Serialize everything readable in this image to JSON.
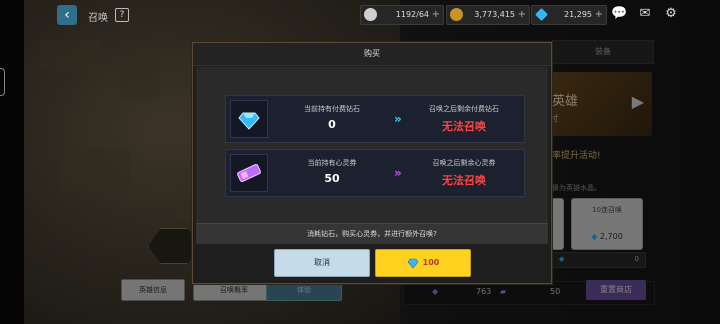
{
  "header": {
    "title": "召唤",
    "help": "?",
    "resources": [
      {
        "name": "stamina",
        "value": "1192/64",
        "color": "#cfcfcf"
      },
      {
        "name": "gold",
        "value": "3,773,415",
        "color": "#c9932a"
      },
      {
        "name": "gems",
        "value": "21,295",
        "color": "#2fb7ff"
      }
    ]
  },
  "right_panel": {
    "tab": "装备",
    "banner_title": "英雄",
    "banner_sub": "付",
    "event_text": "率提升活动!",
    "note": "换为英雄水晶。",
    "card_left_price": "0",
    "card_right_label": "10连召唤",
    "card_right_price": "2,700",
    "strip_value": "0",
    "bottom_count_a": "763",
    "bottom_count_b": "50",
    "shop_button": "重置商店"
  },
  "bottom_buttons": [
    "英雄信息",
    "召唤概率",
    "体验"
  ],
  "modal": {
    "title": "购买",
    "rows": [
      {
        "icon": "diamond-icon",
        "left_label": "当前持有付费钻石",
        "left_value": "0",
        "arrow_color": "#39d0ff",
        "right_label": "召唤之后剩余付费钻石",
        "right_value": "无法召唤"
      },
      {
        "icon": "soul-ticket-icon",
        "left_label": "当前持有心灵券",
        "left_value": "50",
        "arrow_color": "#d34bff",
        "right_label": "召唤之后剩余心灵券",
        "right_value": "无法召唤"
      }
    ],
    "confirm_text": "消耗钻石，购买心灵券，并进行额外召唤?",
    "cancel_label": "取消",
    "buy_amount": "100"
  },
  "colors": {
    "accent_red": "#ff4343",
    "buy_yellow": "#ffd21f",
    "cancel_blue": "#c6dbe9"
  }
}
